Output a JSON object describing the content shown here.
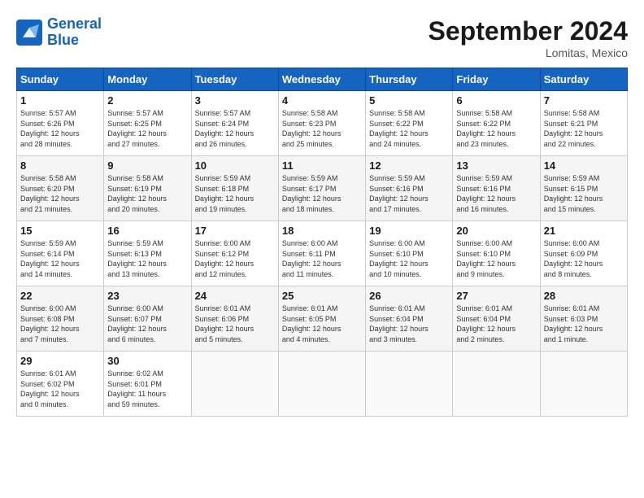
{
  "header": {
    "logo_line1": "General",
    "logo_line2": "Blue",
    "month": "September 2024",
    "location": "Lomitas, Mexico"
  },
  "weekdays": [
    "Sunday",
    "Monday",
    "Tuesday",
    "Wednesday",
    "Thursday",
    "Friday",
    "Saturday"
  ],
  "weeks": [
    [
      {
        "day": "1",
        "info": "Sunrise: 5:57 AM\nSunset: 6:26 PM\nDaylight: 12 hours\nand 28 minutes."
      },
      {
        "day": "2",
        "info": "Sunrise: 5:57 AM\nSunset: 6:25 PM\nDaylight: 12 hours\nand 27 minutes."
      },
      {
        "day": "3",
        "info": "Sunrise: 5:57 AM\nSunset: 6:24 PM\nDaylight: 12 hours\nand 26 minutes."
      },
      {
        "day": "4",
        "info": "Sunrise: 5:58 AM\nSunset: 6:23 PM\nDaylight: 12 hours\nand 25 minutes."
      },
      {
        "day": "5",
        "info": "Sunrise: 5:58 AM\nSunset: 6:22 PM\nDaylight: 12 hours\nand 24 minutes."
      },
      {
        "day": "6",
        "info": "Sunrise: 5:58 AM\nSunset: 6:22 PM\nDaylight: 12 hours\nand 23 minutes."
      },
      {
        "day": "7",
        "info": "Sunrise: 5:58 AM\nSunset: 6:21 PM\nDaylight: 12 hours\nand 22 minutes."
      }
    ],
    [
      {
        "day": "8",
        "info": "Sunrise: 5:58 AM\nSunset: 6:20 PM\nDaylight: 12 hours\nand 21 minutes."
      },
      {
        "day": "9",
        "info": "Sunrise: 5:58 AM\nSunset: 6:19 PM\nDaylight: 12 hours\nand 20 minutes."
      },
      {
        "day": "10",
        "info": "Sunrise: 5:59 AM\nSunset: 6:18 PM\nDaylight: 12 hours\nand 19 minutes."
      },
      {
        "day": "11",
        "info": "Sunrise: 5:59 AM\nSunset: 6:17 PM\nDaylight: 12 hours\nand 18 minutes."
      },
      {
        "day": "12",
        "info": "Sunrise: 5:59 AM\nSunset: 6:16 PM\nDaylight: 12 hours\nand 17 minutes."
      },
      {
        "day": "13",
        "info": "Sunrise: 5:59 AM\nSunset: 6:16 PM\nDaylight: 12 hours\nand 16 minutes."
      },
      {
        "day": "14",
        "info": "Sunrise: 5:59 AM\nSunset: 6:15 PM\nDaylight: 12 hours\nand 15 minutes."
      }
    ],
    [
      {
        "day": "15",
        "info": "Sunrise: 5:59 AM\nSunset: 6:14 PM\nDaylight: 12 hours\nand 14 minutes."
      },
      {
        "day": "16",
        "info": "Sunrise: 5:59 AM\nSunset: 6:13 PM\nDaylight: 12 hours\nand 13 minutes."
      },
      {
        "day": "17",
        "info": "Sunrise: 6:00 AM\nSunset: 6:12 PM\nDaylight: 12 hours\nand 12 minutes."
      },
      {
        "day": "18",
        "info": "Sunrise: 6:00 AM\nSunset: 6:11 PM\nDaylight: 12 hours\nand 11 minutes."
      },
      {
        "day": "19",
        "info": "Sunrise: 6:00 AM\nSunset: 6:10 PM\nDaylight: 12 hours\nand 10 minutes."
      },
      {
        "day": "20",
        "info": "Sunrise: 6:00 AM\nSunset: 6:10 PM\nDaylight: 12 hours\nand 9 minutes."
      },
      {
        "day": "21",
        "info": "Sunrise: 6:00 AM\nSunset: 6:09 PM\nDaylight: 12 hours\nand 8 minutes."
      }
    ],
    [
      {
        "day": "22",
        "info": "Sunrise: 6:00 AM\nSunset: 6:08 PM\nDaylight: 12 hours\nand 7 minutes."
      },
      {
        "day": "23",
        "info": "Sunrise: 6:00 AM\nSunset: 6:07 PM\nDaylight: 12 hours\nand 6 minutes."
      },
      {
        "day": "24",
        "info": "Sunrise: 6:01 AM\nSunset: 6:06 PM\nDaylight: 12 hours\nand 5 minutes."
      },
      {
        "day": "25",
        "info": "Sunrise: 6:01 AM\nSunset: 6:05 PM\nDaylight: 12 hours\nand 4 minutes."
      },
      {
        "day": "26",
        "info": "Sunrise: 6:01 AM\nSunset: 6:04 PM\nDaylight: 12 hours\nand 3 minutes."
      },
      {
        "day": "27",
        "info": "Sunrise: 6:01 AM\nSunset: 6:04 PM\nDaylight: 12 hours\nand 2 minutes."
      },
      {
        "day": "28",
        "info": "Sunrise: 6:01 AM\nSunset: 6:03 PM\nDaylight: 12 hours\nand 1 minute."
      }
    ],
    [
      {
        "day": "29",
        "info": "Sunrise: 6:01 AM\nSunset: 6:02 PM\nDaylight: 12 hours\nand 0 minutes."
      },
      {
        "day": "30",
        "info": "Sunrise: 6:02 AM\nSunset: 6:01 PM\nDaylight: 11 hours\nand 59 minutes."
      },
      {
        "day": "",
        "info": ""
      },
      {
        "day": "",
        "info": ""
      },
      {
        "day": "",
        "info": ""
      },
      {
        "day": "",
        "info": ""
      },
      {
        "day": "",
        "info": ""
      }
    ]
  ]
}
